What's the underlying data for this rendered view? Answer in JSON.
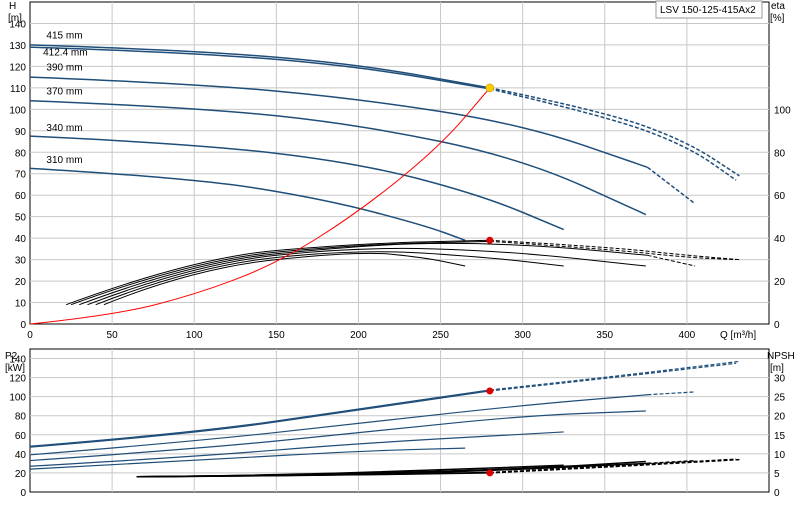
{
  "title_box": "LSV 150-125-415Ax2",
  "colors": {
    "curve": "#1f4e79",
    "system_curve": "#ff0000",
    "operating_point_upper": "#ffcc00",
    "operating_point": "#dd0000",
    "grid": "#c8c8c8",
    "axis": "#000000"
  },
  "chart_data": [
    {
      "type": "line",
      "name": "head-efficiency",
      "ylabel": "H",
      "yunit": "[m]",
      "y2label": "eta",
      "y2unit": "[%]",
      "xlabel": "Q [m³/h]",
      "xlim": [
        0,
        450
      ],
      "ylim": [
        0,
        150
      ],
      "y2lim": [
        0,
        150
      ],
      "x_ticks": [
        0,
        50,
        100,
        150,
        200,
        250,
        300,
        350,
        400
      ],
      "y_ticks": [
        0,
        10,
        20,
        30,
        40,
        50,
        60,
        70,
        80,
        90,
        100,
        110,
        120,
        130,
        140
      ],
      "y2_ticks": [
        0,
        20,
        40,
        60,
        80,
        100
      ],
      "grid": true,
      "head_curves": [
        {
          "name": "415 mm",
          "points": [
            [
              0,
              130
            ],
            [
              100,
              127.5
            ],
            [
              200,
              121
            ],
            [
              280,
              110
            ]
          ],
          "dashed": [
            [
              280,
              110
            ],
            [
              350,
              99
            ],
            [
              400,
              85
            ],
            [
              432,
              69
            ]
          ]
        },
        {
          "name": "412.4 mm",
          "points": [
            [
              0,
              129
            ],
            [
              100,
              126.5
            ],
            [
              200,
              120
            ],
            [
              280,
              109.5
            ]
          ],
          "dashed": [
            [
              280,
              109.5
            ],
            [
              350,
              97
            ],
            [
              400,
              83
            ],
            [
              430,
              67
            ]
          ]
        },
        {
          "name": "390 mm",
          "points": [
            [
              0,
              115
            ],
            [
              100,
              112
            ],
            [
              200,
              105
            ],
            [
              300,
              93
            ],
            [
              376,
              73
            ]
          ],
          "dashed": [
            [
              376,
              73
            ],
            [
              405,
              56
            ]
          ]
        },
        {
          "name": "370 mm",
          "points": [
            [
              0,
              104
            ],
            [
              100,
              101
            ],
            [
              200,
              93
            ],
            [
              300,
              77
            ],
            [
              375,
              51
            ]
          ]
        },
        {
          "name": "340 mm",
          "points": [
            [
              0,
              87.5
            ],
            [
              100,
              84
            ],
            [
              200,
              75
            ],
            [
              275,
              60
            ],
            [
              325,
              44
            ]
          ]
        },
        {
          "name": "310 mm",
          "points": [
            [
              0,
              72.5
            ],
            [
              100,
              68
            ],
            [
              180,
              58
            ],
            [
              240,
              46
            ],
            [
              265,
              39
            ]
          ]
        }
      ],
      "efficiency_curves": [
        {
          "points": [
            [
              22,
              9
            ],
            [
              100,
              31
            ],
            [
              200,
              37.5
            ],
            [
              280,
              39
            ]
          ],
          "dashed": [
            [
              280,
              39
            ],
            [
              350,
              36
            ],
            [
              400,
              32
            ],
            [
              432,
              30
            ]
          ]
        },
        {
          "points": [
            [
              25,
              9
            ],
            [
              100,
              30
            ],
            [
              200,
              37
            ],
            [
              280,
              38.5
            ]
          ],
          "dashed": [
            [
              280,
              38.5
            ],
            [
              350,
              35
            ],
            [
              400,
              31
            ],
            [
              430,
              30
            ]
          ]
        },
        {
          "points": [
            [
              30,
              9
            ],
            [
              100,
              29
            ],
            [
              200,
              36.5
            ],
            [
              260,
              38
            ],
            [
              320,
              36
            ],
            [
              376,
              32
            ]
          ],
          "dashed": [
            [
              376,
              32
            ],
            [
              405,
              27
            ]
          ]
        },
        {
          "points": [
            [
              35,
              9
            ],
            [
              100,
              28
            ],
            [
              200,
              36
            ],
            [
              290,
              34
            ],
            [
              375,
              27
            ]
          ]
        },
        {
          "points": [
            [
              40,
              9
            ],
            [
              100,
              27
            ],
            [
              200,
              35
            ],
            [
              280,
              31
            ],
            [
              325,
              27
            ]
          ]
        },
        {
          "points": [
            [
              45,
              9
            ],
            [
              100,
              26
            ],
            [
              200,
              34
            ],
            [
              240,
              31
            ],
            [
              265,
              27
            ]
          ]
        }
      ],
      "system_curve": [
        [
          0,
          0
        ],
        [
          50,
          4
        ],
        [
          100,
          13.5
        ],
        [
          150,
          28
        ],
        [
          200,
          52
        ],
        [
          250,
          83
        ],
        [
          280,
          110
        ]
      ],
      "operating_point_top": [
        280,
        110
      ],
      "operating_point_eta": [
        280,
        39
      ],
      "curve_labels": [
        {
          "text": "415 mm",
          "at": [
            10,
            133
          ]
        },
        {
          "text": "412.4 mm",
          "at": [
            8,
            125
          ]
        },
        {
          "text": "390 mm",
          "at": [
            10,
            118
          ]
        },
        {
          "text": "370 mm",
          "at": [
            10,
            107
          ]
        },
        {
          "text": "340 mm",
          "at": [
            10,
            90
          ]
        },
        {
          "text": "310 mm",
          "at": [
            10,
            75
          ]
        }
      ]
    },
    {
      "type": "line",
      "name": "power-npsh",
      "ylabel": "P2",
      "yunit": "[kW]",
      "y2label": "NPSH",
      "y2unit": "[m]",
      "xlim": [
        0,
        450
      ],
      "ylim": [
        0,
        150
      ],
      "y2lim": [
        0,
        37.5
      ],
      "y_ticks": [
        0,
        20,
        40,
        60,
        80,
        100,
        120,
        140
      ],
      "y2_ticks": [
        0,
        5,
        10,
        15,
        20,
        25,
        30
      ],
      "grid": true,
      "power_curves": [
        {
          "points": [
            [
              0,
              48
            ],
            [
              100,
              62
            ],
            [
              200,
              87
            ],
            [
              280,
              107
            ]
          ],
          "dashed": [
            [
              280,
              107
            ],
            [
              350,
              120
            ],
            [
              432,
              137
            ]
          ]
        },
        {
          "points": [
            [
              0,
              47
            ],
            [
              100,
              61
            ],
            [
              200,
              86
            ],
            [
              280,
              106
            ]
          ],
          "dashed": [
            [
              280,
              106
            ],
            [
              350,
              119
            ],
            [
              430,
              135
            ]
          ]
        },
        {
          "points": [
            [
              0,
              39
            ],
            [
              100,
              53
            ],
            [
              200,
              72
            ],
            [
              300,
              91
            ],
            [
              376,
              102
            ]
          ],
          "dashed": [
            [
              376,
              102
            ],
            [
              405,
              105
            ]
          ]
        },
        {
          "points": [
            [
              0,
              33
            ],
            [
              100,
              45
            ],
            [
              200,
              62
            ],
            [
              300,
              80
            ],
            [
              375,
              85
            ]
          ]
        },
        {
          "points": [
            [
              0,
              27
            ],
            [
              100,
              37
            ],
            [
              200,
              51
            ],
            [
              325,
              63
            ]
          ]
        },
        {
          "points": [
            [
              0,
              24
            ],
            [
              100,
              33
            ],
            [
              200,
              43
            ],
            [
              265,
              46
            ]
          ]
        }
      ],
      "npsh_curves": [
        {
          "points": [
            [
              65,
              4
            ],
            [
              150,
              4.2
            ],
            [
              280,
              5
            ]
          ],
          "dashed": [
            [
              280,
              5
            ],
            [
              350,
              6.5
            ],
            [
              432,
              8.5
            ]
          ]
        },
        {
          "points": [
            [
              65,
              4
            ],
            [
              150,
              4.2
            ],
            [
              280,
              5.1
            ]
          ],
          "dashed": [
            [
              280,
              5.1
            ],
            [
              350,
              6.7
            ],
            [
              430,
              8.6
            ]
          ]
        },
        {
          "points": [
            [
              65,
              4
            ],
            [
              150,
              4.2
            ],
            [
              260,
              5.2
            ],
            [
              376,
              7.5
            ]
          ],
          "dashed": [
            [
              376,
              7.5
            ],
            [
              405,
              8.2
            ]
          ]
        },
        {
          "points": [
            [
              65,
              4
            ],
            [
              150,
              4.3
            ],
            [
              300,
              6
            ],
            [
              375,
              8
            ]
          ]
        },
        {
          "points": [
            [
              65,
              4
            ],
            [
              150,
              4.4
            ],
            [
              250,
              5.8
            ],
            [
              325,
              7
            ]
          ]
        }
      ],
      "operating_point_power": [
        280,
        106
      ],
      "operating_point_npsh": [
        280,
        5
      ]
    }
  ]
}
